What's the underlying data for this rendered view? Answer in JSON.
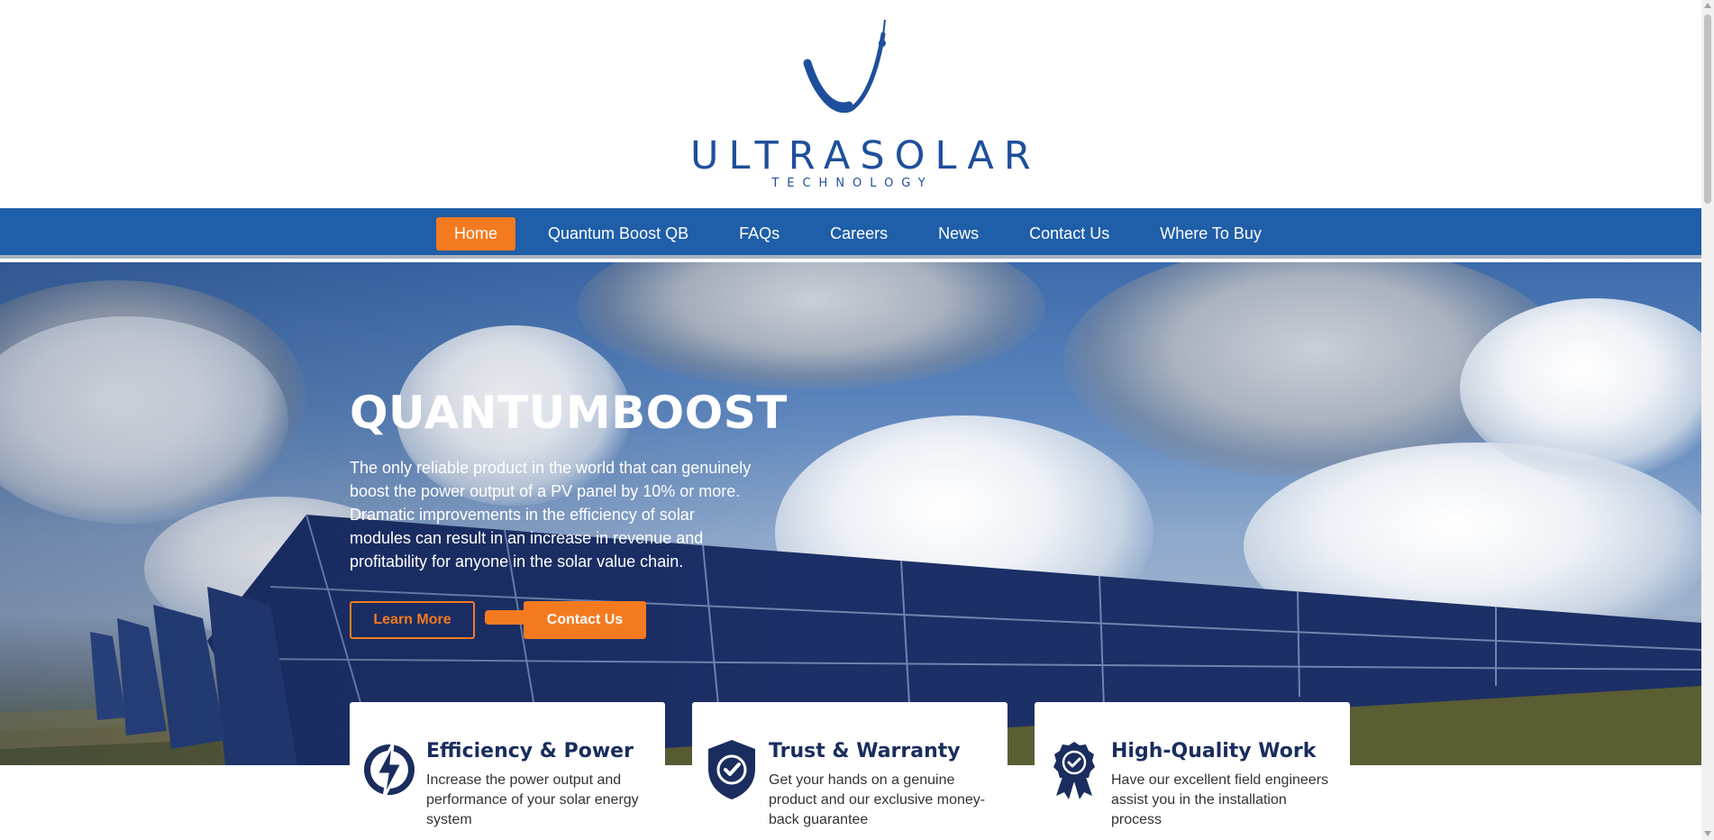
{
  "brand": {
    "name": "ULTRASOLAR",
    "tagline": "TECHNOLOGY",
    "color": "#1e4f9c"
  },
  "nav": {
    "items": [
      {
        "label": "Home",
        "active": true
      },
      {
        "label": "Quantum Boost QB",
        "active": false
      },
      {
        "label": "FAQs",
        "active": false
      },
      {
        "label": "Careers",
        "active": false
      },
      {
        "label": "News",
        "active": false
      },
      {
        "label": "Contact Us",
        "active": false
      },
      {
        "label": "Where To Buy",
        "active": false
      }
    ],
    "bg_color": "#1f5ea8",
    "active_color": "#f47a20"
  },
  "hero": {
    "title": "QUANTUMBOOST",
    "text": "The only reliable product in the world that can genuinely boost the power output of a PV panel by 10% or more. Dramatic improvements in the efficiency of solar modules can result in an increase in revenue and profitability for anyone in the solar value chain.",
    "learn_more": "Learn More",
    "contact": "Contact Us",
    "accent": "#f47a20"
  },
  "features": [
    {
      "icon": "lightning-bolt-icon",
      "title": "Efficiency & Power",
      "text": "Increase the power output and performance of your solar energy system"
    },
    {
      "icon": "shield-check-icon",
      "title": "Trust & Warranty",
      "text": "Get your hands on a genuine product and our exclusive money-back guarantee"
    },
    {
      "icon": "award-badge-icon",
      "title": "High-Quality Work",
      "text": "Have our excellent field engineers assist you in the installation process"
    }
  ]
}
